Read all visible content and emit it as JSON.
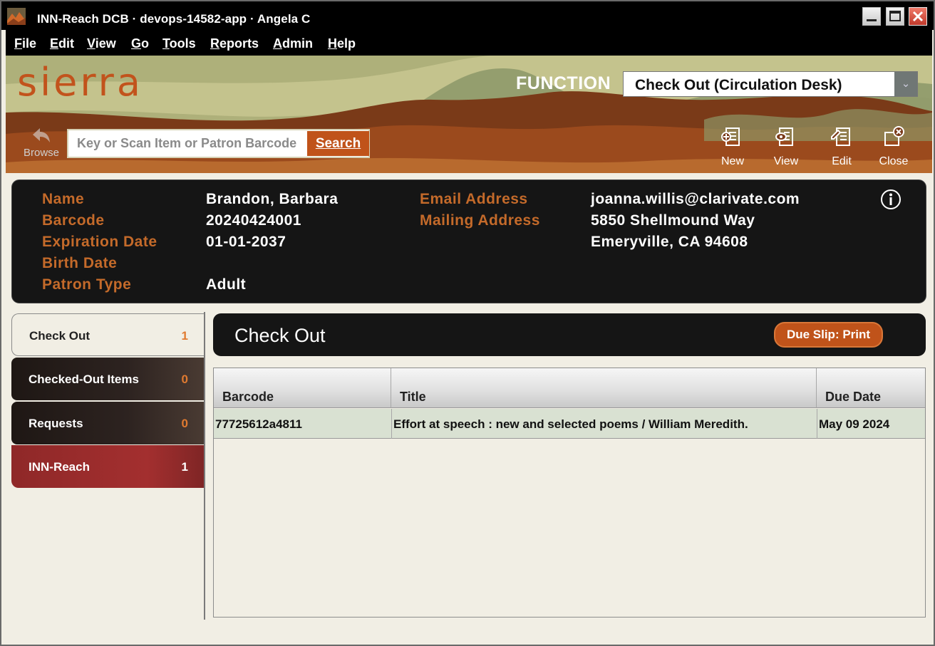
{
  "window": {
    "title": "INN-Reach DCB · devops-14582-app · Angela C"
  },
  "menu": [
    "File",
    "Edit",
    "View",
    "Go",
    "Tools",
    "Reports",
    "Admin",
    "Help"
  ],
  "header": {
    "logo": "sierra",
    "function_label": "FUNCTION",
    "function_value": "Check Out (Circulation Desk)",
    "browse_label": "Browse",
    "search_placeholder": "Key or Scan Item or Patron Barcode",
    "search_button": "Search",
    "tools": [
      {
        "label": "New",
        "icon": "new-record-icon"
      },
      {
        "label": "View",
        "icon": "view-record-icon"
      },
      {
        "label": "Edit",
        "icon": "edit-record-icon"
      },
      {
        "label": "Close",
        "icon": "close-record-icon"
      }
    ]
  },
  "patron": {
    "labels": {
      "name": "Name",
      "barcode": "Barcode",
      "expiration": "Expiration Date",
      "birth": "Birth Date",
      "ptype": "Patron Type",
      "email": "Email Address",
      "mailing": "Mailing Address"
    },
    "values": {
      "name": "Brandon, Barbara",
      "barcode": "20240424001",
      "expiration": "01-01-2037",
      "ptype": "Adult",
      "email": "joanna.willis@clarivate.com",
      "address1": "5850 Shellmound Way",
      "address2": "Emeryville, CA 94608"
    }
  },
  "tabs": [
    {
      "label": "Check Out",
      "count": "1"
    },
    {
      "label": "Checked-Out Items",
      "count": "0"
    },
    {
      "label": "Requests",
      "count": "0"
    },
    {
      "label": "INN-Reach",
      "count": "1"
    }
  ],
  "panel": {
    "title": "Check Out",
    "due_slip_button": "Due Slip: Print"
  },
  "table": {
    "columns": [
      "Barcode",
      "Title",
      "Due Date"
    ],
    "rows": [
      [
        "77725612a4811",
        "Effort at speech : new and selected poems / William Meredith.",
        "May 09 2024"
      ]
    ]
  },
  "colors": {
    "accent_orange": "#c0531a",
    "label_orange": "#c46a2a",
    "inn_reach_red": "#a32f2f"
  }
}
